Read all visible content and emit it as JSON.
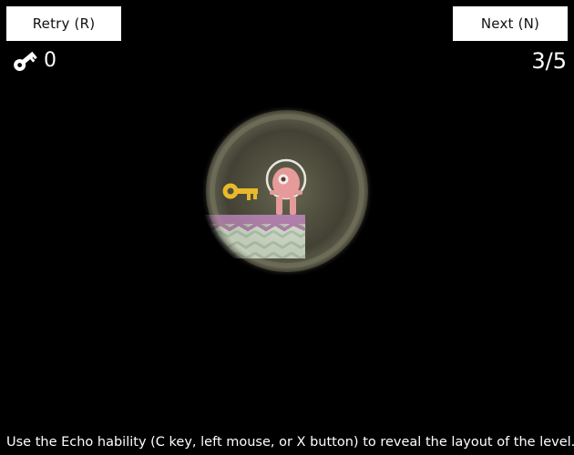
{
  "hud": {
    "retry_label": "Retry (R)",
    "next_label": "Next (N)",
    "keys_collected": "0",
    "level_progress": "3/5"
  },
  "hint": {
    "text": "Use the Echo hability (C key, left mouse, or X button) to reveal the layout of the level."
  },
  "icons": {
    "key_counter_icon": "key-icon",
    "game_key": "key-icon",
    "player": "astronaut-character"
  },
  "colors": {
    "background": "#000000",
    "button_bg": "#ffffff",
    "button_text": "#111111",
    "hud_text": "#ffffff",
    "key_gold": "#e8b92b",
    "player_pink": "#e79a9a",
    "platform_top": "#b97fb6",
    "platform_body": "#d8e8d4",
    "echo_glow": "#6b6a52"
  }
}
